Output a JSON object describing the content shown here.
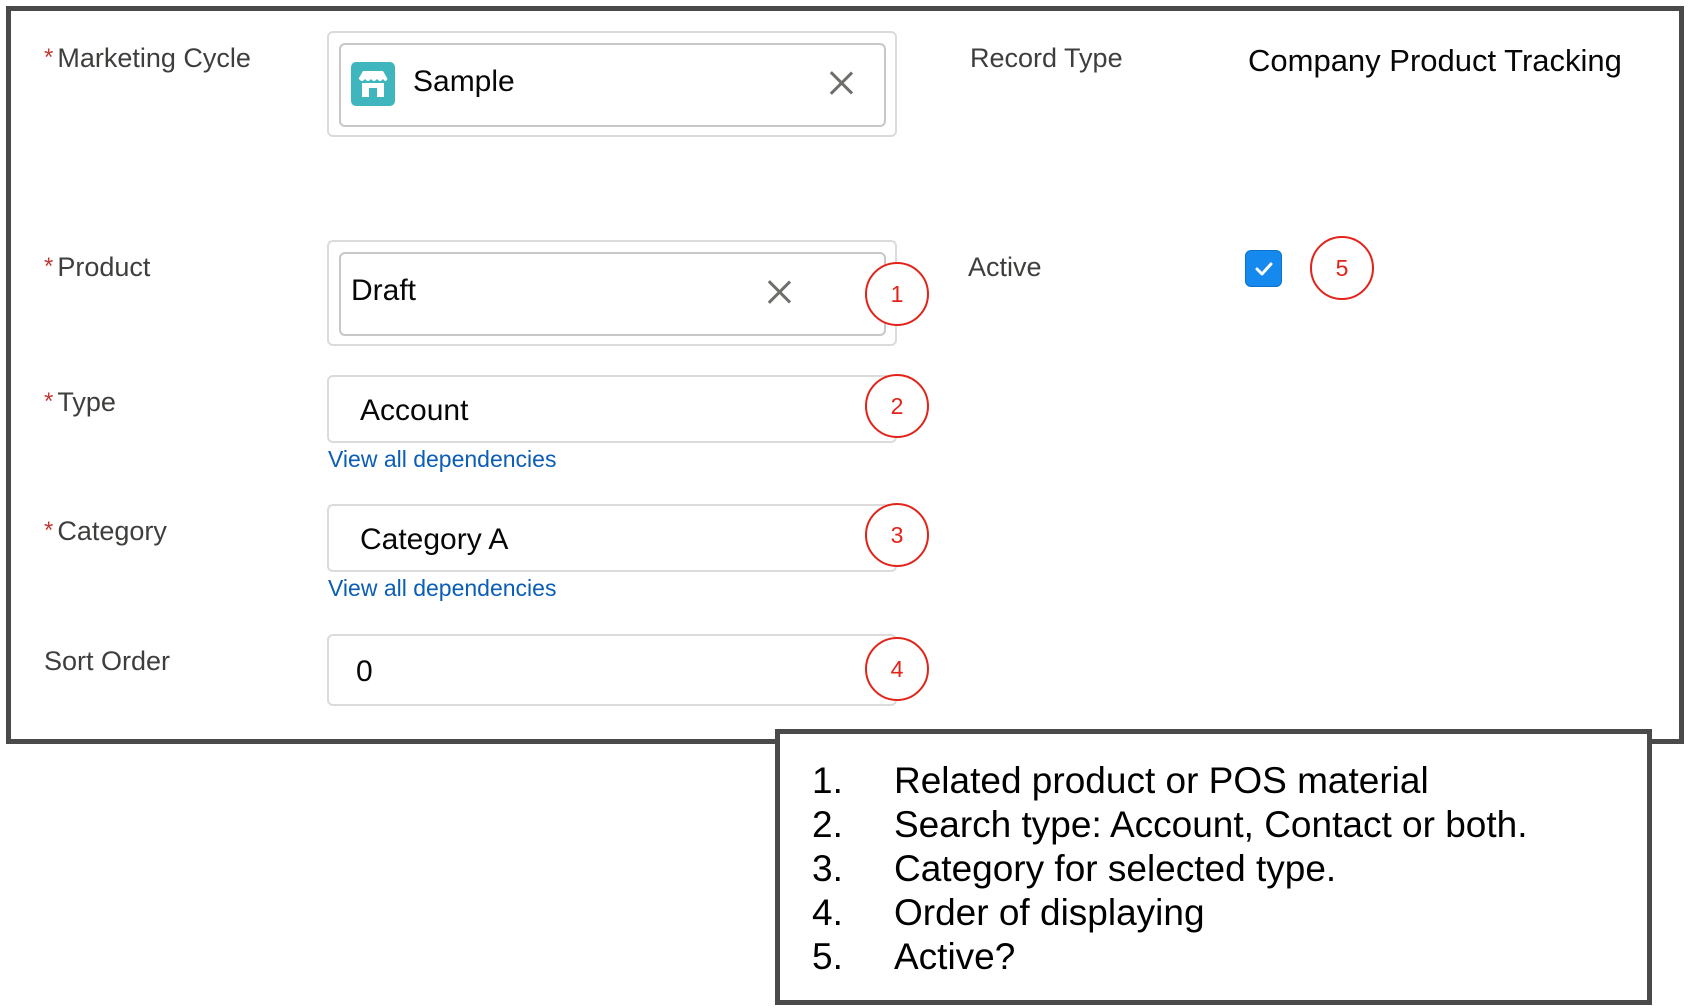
{
  "form": {
    "marketing_cycle_label": "Marketing Cycle",
    "marketing_cycle_value": "Sample",
    "record_type_label": "Record Type",
    "record_type_value": "Company Product Tracking",
    "product_label": "Product",
    "product_value": "Draft",
    "active_label": "Active",
    "active_checked": true,
    "type_label": "Type",
    "type_value": "Account",
    "category_label": "Category",
    "category_value": "Category A",
    "sort_order_label": "Sort Order",
    "sort_order_value": "0",
    "dependencies_link": "View all dependencies",
    "required_marker": "*"
  },
  "badges": [
    "1",
    "2",
    "3",
    "4",
    "5"
  ],
  "legend": [
    {
      "num": "1.",
      "text": "Related product or POS material"
    },
    {
      "num": "2.",
      "text": "Search type: Account, Contact or both."
    },
    {
      "num": "3.",
      "text": "Category for selected type."
    },
    {
      "num": "4.",
      "text": "Order of displaying"
    },
    {
      "num": "5.",
      "text": "Active?"
    }
  ],
  "colors": {
    "required": "#c23934",
    "link": "#0b5db6",
    "checkbox": "#1589ee",
    "badge": "#e2231a",
    "app_icon": "#3fb5bd"
  },
  "icons": {
    "marketing_cycle": "store-icon",
    "clear": "close-icon",
    "dropdown": "caret-down-icon",
    "checkbox": "check-icon"
  }
}
